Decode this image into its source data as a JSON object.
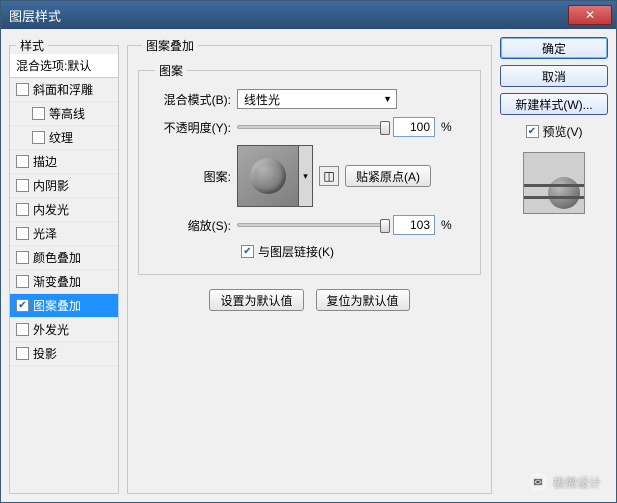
{
  "window": {
    "title": "图层样式"
  },
  "sidebar": {
    "legend": "样式",
    "blendDefaults": "混合选项:默认",
    "items": [
      {
        "label": "斜面和浮雕",
        "checked": false,
        "selected": false,
        "indent": false
      },
      {
        "label": "等高线",
        "checked": false,
        "selected": false,
        "indent": true
      },
      {
        "label": "纹理",
        "checked": false,
        "selected": false,
        "indent": true
      },
      {
        "label": "描边",
        "checked": false,
        "selected": false,
        "indent": false
      },
      {
        "label": "内阴影",
        "checked": false,
        "selected": false,
        "indent": false
      },
      {
        "label": "内发光",
        "checked": false,
        "selected": false,
        "indent": false
      },
      {
        "label": "光泽",
        "checked": false,
        "selected": false,
        "indent": false
      },
      {
        "label": "颜色叠加",
        "checked": false,
        "selected": false,
        "indent": false
      },
      {
        "label": "渐变叠加",
        "checked": false,
        "selected": false,
        "indent": false
      },
      {
        "label": "图案叠加",
        "checked": true,
        "selected": true,
        "indent": false
      },
      {
        "label": "外发光",
        "checked": false,
        "selected": false,
        "indent": false
      },
      {
        "label": "投影",
        "checked": false,
        "selected": false,
        "indent": false
      }
    ]
  },
  "center": {
    "outerLegend": "图案叠加",
    "innerLegend": "图案",
    "blendModeLabel": "混合模式(B):",
    "blendModeValue": "线性光",
    "opacityLabel": "不透明度(Y):",
    "opacityValue": "100",
    "percent": "%",
    "patternLabel": "图案:",
    "snapOriginBtn": "贴紧原点(A)",
    "scaleLabel": "缩放(S):",
    "scaleValue": "103",
    "linkWithLayerLabel": "与图层链接(K)",
    "linkWithLayerChecked": true,
    "setDefaultBtn": "设置为默认值",
    "resetDefaultBtn": "复位为默认值"
  },
  "right": {
    "ok": "确定",
    "cancel": "取消",
    "newStyle": "新建样式(W)...",
    "previewLabel": "预览(V)",
    "previewChecked": true
  },
  "watermark": "极微设计"
}
